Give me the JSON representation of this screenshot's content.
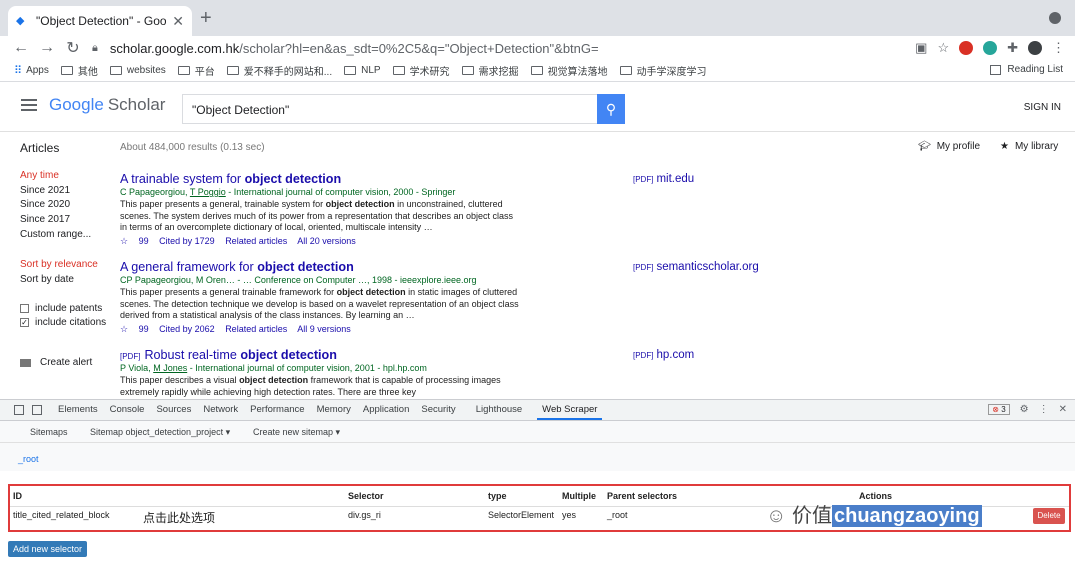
{
  "browser": {
    "tab_title": "\"Object Detection\" - Google S",
    "new_tab": "+",
    "url_domain": "scholar.google.com.hk",
    "url_path": "/scholar?hl=en&as_sdt=0%2C5&q=\"Object+Detection\"&btnG=",
    "bookmarks": [
      "Apps",
      "其他",
      "websites",
      "平台",
      "爱不释手的网站和...",
      "NLP",
      "学术研究",
      "需求挖掘",
      "视觉算法落地",
      "动手学深度学习"
    ],
    "reading_list": "Reading List"
  },
  "scholar": {
    "logo_google": "Google",
    "logo_scholar": "Scholar",
    "query": "\"Object Detection\"",
    "sign_in": "SIGN IN",
    "articles_label": "Articles",
    "result_count": "About 484,000 results (0.13 sec)",
    "my_profile": "My profile",
    "my_library": "My library",
    "sidebar": {
      "time": [
        "Any time",
        "Since 2021",
        "Since 2020",
        "Since 2017",
        "Custom range..."
      ],
      "sort": [
        "Sort by relevance",
        "Sort by date"
      ],
      "include_patents": "include patents",
      "include_citations": "include citations",
      "create_alert": "Create alert"
    },
    "results": [
      {
        "title_pre": "A trainable system for ",
        "title_bold": "object detection",
        "pdf_prefix": "",
        "authors_a": "C Papageorgiou, ",
        "authors_link": "T Poggio",
        "authors_b": " - International journal of computer vision, 2000 - Springer",
        "snippet_a": "This paper presents a general, trainable system for ",
        "snippet_bold": "object detection",
        "snippet_b": " in unconstrained, cluttered scenes. The system derives much of its power from a representation that describes an object class in terms of an overcomplete dictionary of local, oriented, multiscale intensity …",
        "actions": [
          "☆",
          "99",
          "Cited by 1729",
          "Related articles",
          "All 20 versions"
        ],
        "side_label": "[PDF]",
        "side_domain": "mit.edu"
      },
      {
        "title_pre": "A general framework for ",
        "title_bold": "object detection",
        "pdf_prefix": "",
        "authors_a": "CP Papageorgiou, M Oren… - … Conference on Computer …, 1998 - ieeexplore.ieee.org",
        "authors_link": "",
        "authors_b": "",
        "snippet_a": "This paper presents a general trainable framework for ",
        "snippet_bold": "object detection",
        "snippet_b": " in static images of cluttered scenes. The detection technique we develop is based on a wavelet representation of an object class derived from a statistical analysis of the class instances. By learning an …",
        "actions": [
          "☆",
          "99",
          "Cited by 2062",
          "Related articles",
          "All 9 versions"
        ],
        "side_label": "[PDF]",
        "side_domain": "semanticscholar.org"
      },
      {
        "title_pre": "Robust real-time ",
        "title_bold": "object detection",
        "pdf_prefix": "[PDF]",
        "authors_a": "P Viola, ",
        "authors_link": "M Jones",
        "authors_b": " - International journal of computer vision, 2001 - hpl.hp.com",
        "snippet_a": "This paper describes a visual ",
        "snippet_bold": "object detection",
        "snippet_b": " framework that is capable of processing images extremely rapidly while achieving high detection rates. There are three key",
        "actions": [],
        "side_label": "[PDF]",
        "side_domain": "hp.com"
      }
    ]
  },
  "devtools": {
    "tabs": [
      "Elements",
      "Console",
      "Sources",
      "Network",
      "Performance",
      "Memory",
      "Application",
      "Security",
      "Lighthouse",
      "Web Scraper"
    ],
    "active_tab": "Web Scraper",
    "error_count": "3",
    "scraper_nav": [
      "Sitemaps",
      "Sitemap object_detection_project ▾",
      "Create new sitemap ▾"
    ],
    "breadcrumb": "_root",
    "table_headers": [
      "ID",
      "Selector",
      "type",
      "Multiple",
      "Parent selectors",
      "Actions"
    ],
    "row": {
      "id": "title_cited_related_block",
      "note": "点击此处选项",
      "selector": "div.gs_ri",
      "type": "SelectorElement",
      "multiple": "yes",
      "parent": "_root",
      "delete": "Delete"
    },
    "add_selector": "Add new selector"
  },
  "watermark": {
    "prefix": "价值",
    "name": "chuangzaoying"
  }
}
